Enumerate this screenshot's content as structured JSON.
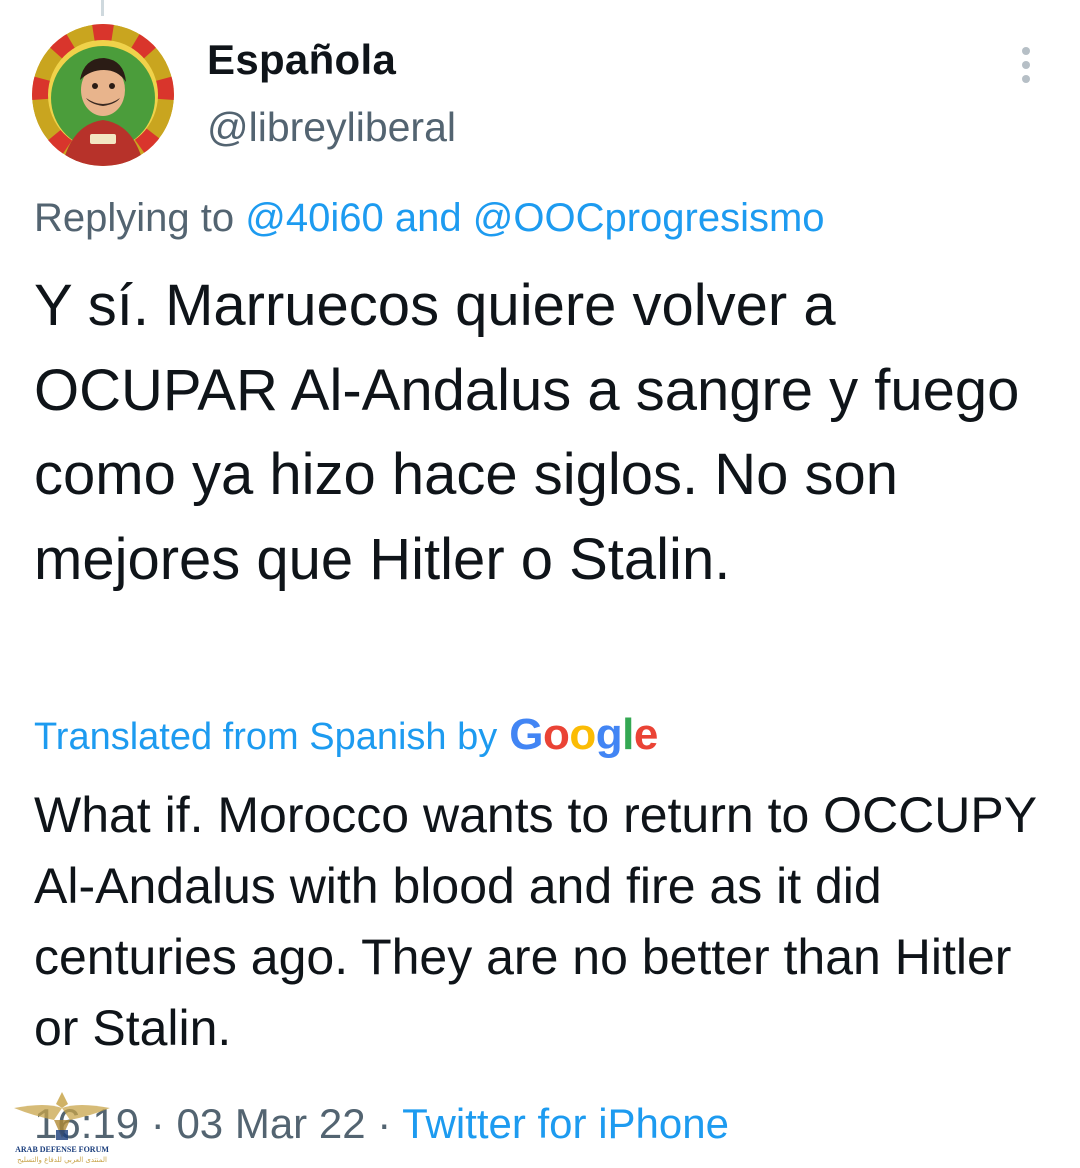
{
  "tweet": {
    "display_name": "Española",
    "handle": "@libreyliberal",
    "avatar_icon": "profile-avatar",
    "more_icon": "more-vertical-icon",
    "replying_prefix": "Replying to",
    "replying_mention_1": "@40i60",
    "replying_and": "and",
    "replying_mention_2": "@OOCprogresismo",
    "text": "Y sí. Marruecos quiere volver a OCUPAR Al-Andalus a sangre y fuego como ya hizo hace siglos. No son mejores que Hitler o Stalin.",
    "translation_label": "Translated from Spanish by",
    "translation_provider": "Google",
    "translated_text": "What if. Morocco wants to return to OCCUPY Al-Andalus with blood and fire as it did centuries ago. They are no better than Hitler or Stalin.",
    "time": "16:19",
    "date": "03 Mar 22",
    "separator": "·",
    "source": "Twitter for iPhone"
  },
  "watermark": {
    "line_1": "ARAB DEFENSE FORUM",
    "line_2": "المنتدى العربي للدفاع والتسليح"
  },
  "colors": {
    "accent": "#1d9bf0",
    "secondary_text": "#536471",
    "primary_text": "#0f1419",
    "background": "#ffffff"
  }
}
